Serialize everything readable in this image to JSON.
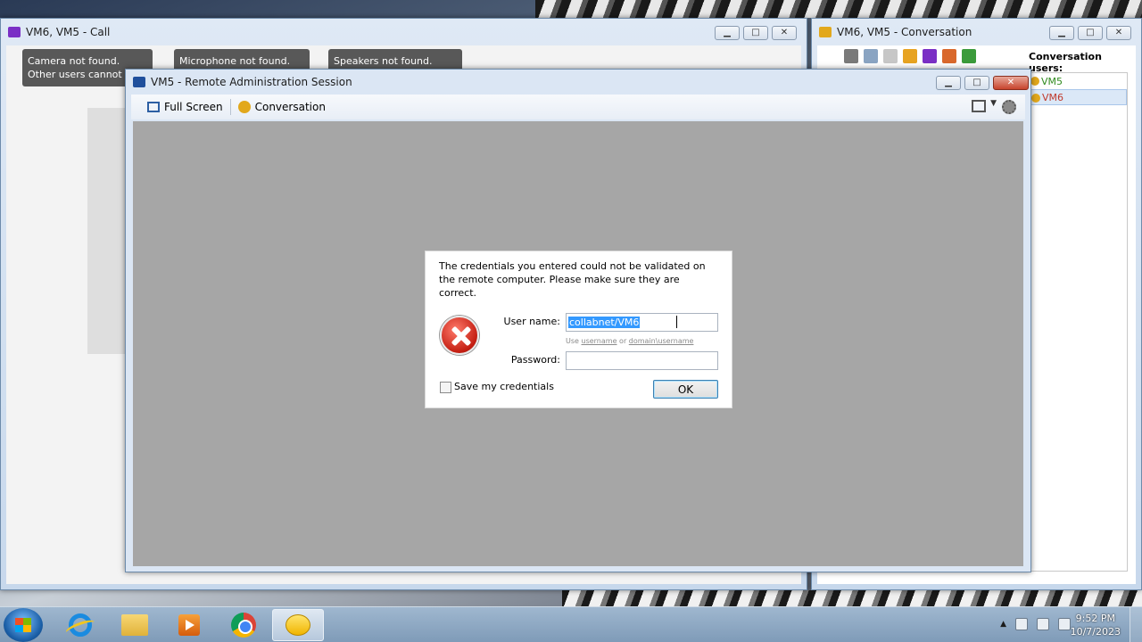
{
  "call_window": {
    "title": "VM6, VM5 - Call",
    "tips": [
      {
        "line1": "Camera not found.",
        "line2": "Other users cannot see"
      },
      {
        "line1": "Microphone not found.",
        "line2": ""
      },
      {
        "line1": "Speakers not found.",
        "line2": ""
      }
    ]
  },
  "conversation_window": {
    "title": "VM6, VM5 - Conversation",
    "users_label": "Conversation users:",
    "users": [
      {
        "name": "VM5",
        "color": "#2f8a1e"
      },
      {
        "name": "VM6",
        "color": "#c0392b"
      }
    ]
  },
  "remote_window": {
    "title": "VM5 - Remote Administration Session",
    "toolbar": {
      "full_screen": "Full Screen",
      "conversation": "Conversation"
    }
  },
  "dialog": {
    "message": "The credentials you entered could not be validated on the remote computer. Please make sure they are correct.",
    "username_label": "User name:",
    "username_value": "collabnet/VM6",
    "hint_prefix": "Use",
    "hint_username": "username",
    "hint_or": "or",
    "hint_domain": "domain\\username",
    "password_label": "Password:",
    "password_value": "",
    "save_label": "Save my credentials",
    "save_checked": false,
    "ok_label": "OK"
  },
  "taskbar": {
    "apps": [
      "internet-explorer-icon",
      "file-explorer-icon",
      "media-player-icon",
      "chrome-icon",
      "chat-icon"
    ],
    "active_app": "chat-icon",
    "time": "9:52 PM",
    "date": "10/7/2023"
  },
  "colors": {
    "accent": "#3399ff",
    "ok_border": "#3c7fb1",
    "canvas": "#a6a6a6"
  }
}
